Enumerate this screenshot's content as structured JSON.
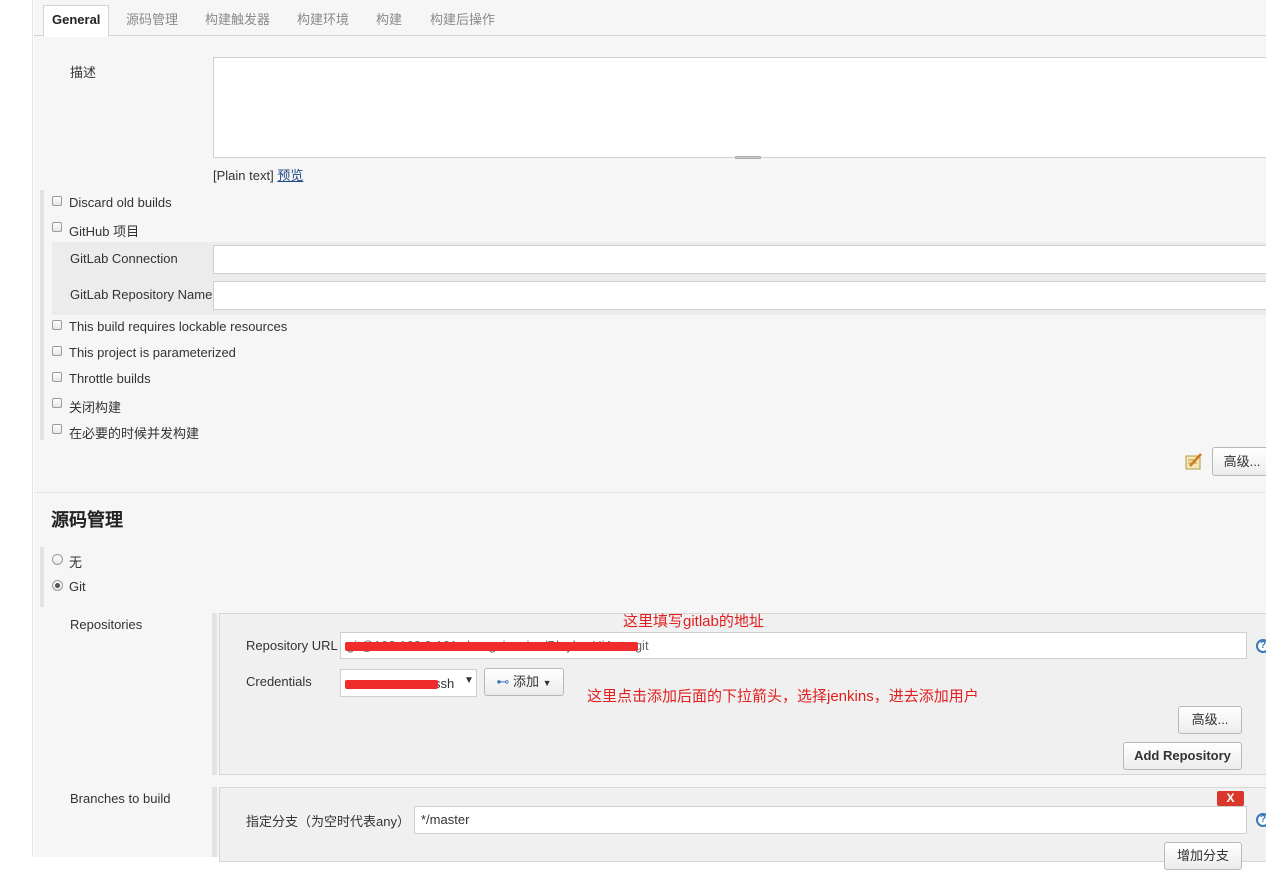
{
  "tabs": [
    "General",
    "源码管理",
    "构建触发器",
    "构建环境",
    "构建",
    "构建后操作"
  ],
  "general": {
    "description_label": "描述",
    "description_value": "",
    "plain_text_prefix": "[Plain text]",
    "preview_link": "预览",
    "options_top": [
      "Discard old builds",
      "GitHub 项目"
    ],
    "gitlab_connection_label": "GitLab Connection",
    "gitlab_connection_value": "",
    "gitlab_repo_label": "GitLab Repository Name",
    "gitlab_repo_value": "",
    "options_bottom": [
      "This build requires lockable resources",
      "This project is parameterized",
      "Throttle builds",
      "关闭构建",
      "在必要的时候并发构建"
    ],
    "advanced_button": "高级..."
  },
  "scm": {
    "title": "源码管理",
    "radio_none": "无",
    "radio_git": "Git",
    "repositories_label": "Repositories",
    "repo_url_label": "Repository URL",
    "repo_url_value": "git@192.168.0.161:zhangxiaoxiao/PlaylowUiAuto.git",
    "credentials_label": "Credentials",
    "credentials_value_suffix": "ssh",
    "add_button": "添加",
    "advanced_button": "高级...",
    "add_repository_button": "Add Repository",
    "annotation_url": "这里填写gitlab的地址",
    "annotation_credentials": "这里点击添加后面的下拉箭头，选择jenkins，进去添加用户",
    "branches_label": "Branches to build",
    "branch_specifier_label": "指定分支（为空时代表any）",
    "branch_specifier_value": "*/master",
    "delete_branch_button": "X",
    "add_branch_button": "增加分支"
  },
  "colors": {
    "annotation": "#e02020",
    "redaction": "#ef2b2b",
    "help": "#3a78b7",
    "delete": "#d9372b"
  }
}
